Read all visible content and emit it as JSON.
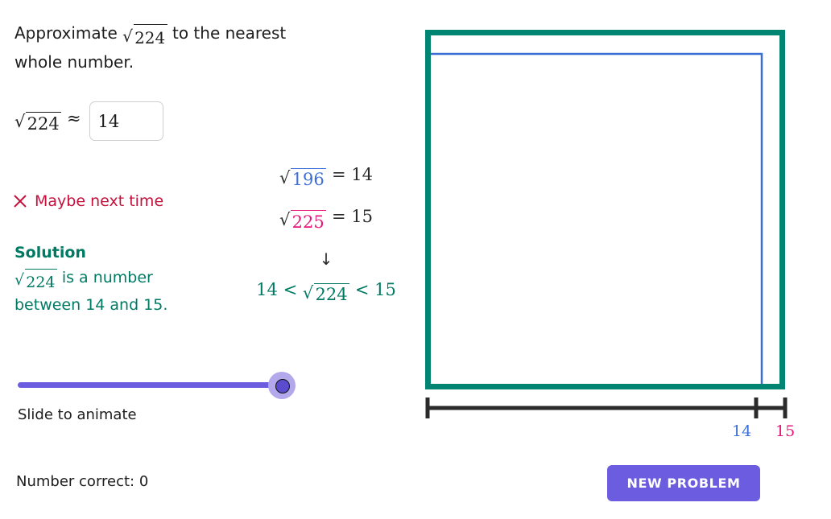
{
  "prompt": {
    "before": "Approximate",
    "radicand": "224",
    "after": "to the nearest whole number."
  },
  "answer": {
    "lhs_radicand": "224",
    "approx_symbol": "≈",
    "value": "14",
    "placeholder": ""
  },
  "feedback": {
    "icon": "cross-icon",
    "text": "Maybe next time",
    "color": "#c4123c"
  },
  "solution": {
    "heading": "Solution",
    "body_radicand": "224",
    "body_text": "is a number between 14 and 15.",
    "color": "#007a63"
  },
  "derivation": {
    "line1": {
      "radicand": "196",
      "equals": "=",
      "result": "14",
      "radicand_color": "#3c6fd5"
    },
    "line2": {
      "radicand": "225",
      "equals": "=",
      "result": "15",
      "radicand_color": "#e5187b"
    },
    "arrow": "↓",
    "conclusion": {
      "lower": "14",
      "lt1": "<",
      "radicand": "224",
      "lt2": "<",
      "upper": "15",
      "color": "#007a63"
    }
  },
  "slider": {
    "label": "Slide to animate",
    "value": 100,
    "min": 0,
    "max": 100,
    "track_color": "#6b5ce0",
    "thumb_color": "#5b4ccd",
    "halo_color": "#b3a8ec"
  },
  "score": {
    "text": "Number correct: 0",
    "label": "Number correct:",
    "value": "0"
  },
  "diagram": {
    "outer_square": {
      "name": "square-225",
      "side_label": "15",
      "color": "#008573",
      "stroke": 7
    },
    "inner_square": {
      "name": "square-196",
      "side_label": "14",
      "color": "#3c6fd5",
      "stroke": 2.5
    },
    "number_line": {
      "color": "#2b2b2b",
      "ticks": [
        {
          "label": "",
          "value": "0"
        },
        {
          "label": "14",
          "value": "14",
          "color": "#3c6fd5"
        },
        {
          "label": "15",
          "value": "15",
          "color": "#e5187b"
        }
      ]
    }
  },
  "buttons": {
    "new_problem": "NEW PROBLEM"
  }
}
